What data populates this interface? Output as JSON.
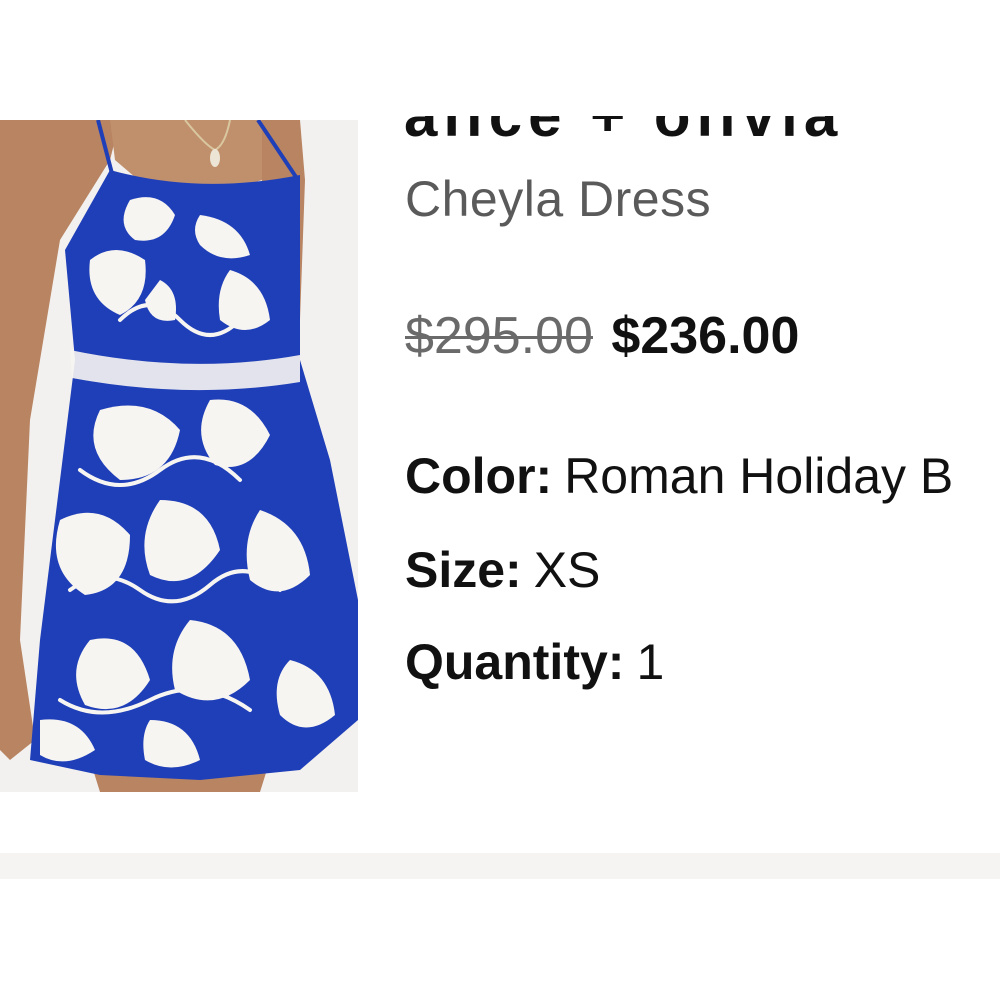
{
  "product": {
    "brand": "alice + olivia",
    "name": "Cheyla Dress",
    "price_original": "$295.00",
    "price_sale": "$236.00",
    "image_alt": "Blue and white printed sleeveless dress",
    "colors": {
      "print_blue": "#1f3fb8",
      "print_white": "#f7f5f2"
    }
  },
  "details": {
    "color_label": "Color:",
    "color_value": "Roman Holiday B",
    "size_label": "Size:",
    "size_value": "XS",
    "quantity_label": "Quantity:",
    "quantity_value": "1"
  }
}
